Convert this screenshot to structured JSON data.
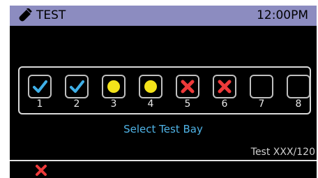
{
  "header": {
    "title": "TEST",
    "time": "12:00PM",
    "icon": "test-tube-icon"
  },
  "bays": [
    {
      "label": "1",
      "state": "checked"
    },
    {
      "label": "2",
      "state": "checked"
    },
    {
      "label": "3",
      "state": "in-progress"
    },
    {
      "label": "4",
      "state": "in-progress"
    },
    {
      "label": "5",
      "state": "failed"
    },
    {
      "label": "6",
      "state": "failed"
    },
    {
      "label": "7",
      "state": "empty"
    },
    {
      "label": "8",
      "state": "empty"
    }
  ],
  "prompt": "Select Test Bay",
  "test_count": "Test XXX/120",
  "footer": {
    "cancel_icon": "close-icon"
  },
  "colors": {
    "header_bg": "#8c8cc0",
    "check": "#3fb0e8",
    "in_progress": "#f4e31a",
    "failed": "#ee3a3a",
    "prompt": "#4fb3e6"
  }
}
